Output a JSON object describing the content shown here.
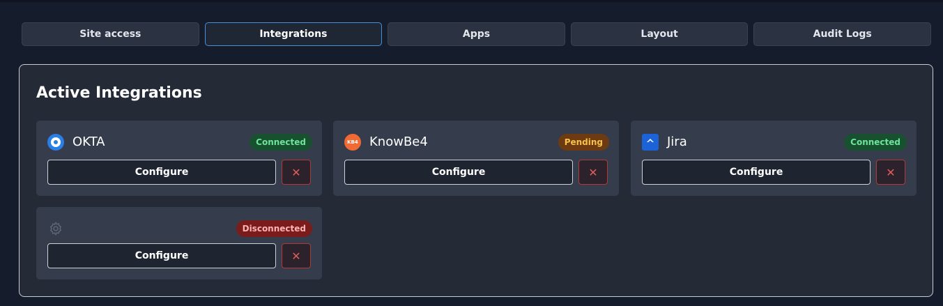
{
  "tabs": [
    {
      "label": "Site access"
    },
    {
      "label": "Integrations"
    },
    {
      "label": "Apps"
    },
    {
      "label": "Layout"
    },
    {
      "label": "Audit Logs"
    }
  ],
  "active_tab": "Integrations",
  "panel": {
    "title": "Active Integrations"
  },
  "integrations": [
    {
      "name": "OKTA",
      "status": "Connected",
      "logo_icon": "okta-logo-icon",
      "configure_label": "Configure",
      "remove_label": "✕"
    },
    {
      "name": "KnowBe4",
      "status": "Pending",
      "logo_icon": "knowbe4-logo-icon",
      "logo_text": "KB4",
      "configure_label": "Configure",
      "remove_label": "✕"
    },
    {
      "name": "Jira",
      "status": "Connected",
      "logo_icon": "jira-logo-icon",
      "configure_label": "Configure",
      "remove_label": "✕"
    },
    {
      "name": "",
      "status": "Disconnected",
      "logo_icon": "gear-icon",
      "configure_label": "Configure",
      "remove_label": "✕"
    }
  ],
  "colors": {
    "accent": "#4a90d9",
    "connected": "#6ee49a",
    "pending": "#f8c14c",
    "disconnected": "#ffb3b3",
    "danger": "#e25c5c"
  }
}
